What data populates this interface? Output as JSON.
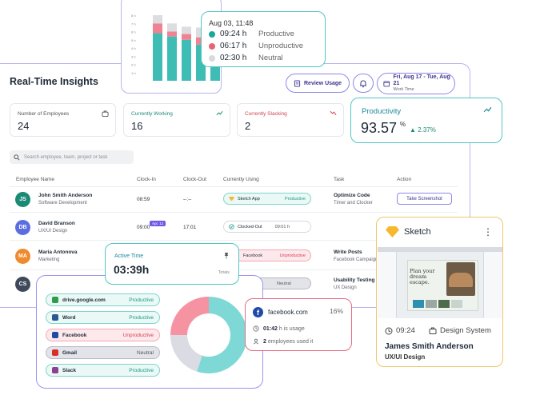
{
  "bar_chart": {
    "tick_labels": [
      "8 h",
      "7 h",
      "6 h",
      "5 h",
      "4 h",
      "3 h",
      "2 h",
      "1 h"
    ],
    "bars": [
      {
        "productive": 5.8,
        "unproductive": 1.2,
        "neutral": 1.0
      },
      {
        "productive": 5.4,
        "unproductive": 0.6,
        "neutral": 1.0
      },
      {
        "productive": 5.0,
        "unproductive": 0.7,
        "neutral": 0.9
      },
      {
        "productive": 4.4,
        "unproductive": 0.9,
        "neutral": 1.2
      },
      {
        "productive": 3.2,
        "unproductive": 0.6,
        "neutral": 1.0
      },
      {
        "productive": 2.0,
        "unproductive": 0.0,
        "neutral": 0.0
      }
    ]
  },
  "tooltip": {
    "when": "Aug 03, 11:48",
    "rows": [
      {
        "hours": "09:24 h",
        "label": "Productive",
        "color": "#1aa897"
      },
      {
        "hours": "06:17 h",
        "label": "Unproductive",
        "color": "#e56476"
      },
      {
        "hours": "02:30 h",
        "label": "Neutral",
        "color": "#d7d9dd"
      }
    ]
  },
  "main": {
    "title": "Real-Time Insights",
    "review_label": "Review Usage",
    "date_range": "Fri, Aug 17 - Tue, Aug 21",
    "date_sub": "Work Time"
  },
  "stats": {
    "employees": {
      "label": "Number of Employees",
      "value": "24"
    },
    "working": {
      "label": "Currently Working",
      "value": "16"
    },
    "slacking": {
      "label": "Currently Slacking",
      "value": "2"
    }
  },
  "productivity": {
    "title": "Productivity",
    "value": "93.57",
    "unit": "%",
    "delta": "2.37%"
  },
  "search": {
    "placeholder": "Search employee, team, project or task"
  },
  "table": {
    "headers": [
      "Employee Name",
      "Clock-In",
      "Clock-Out",
      "Currently Using",
      "Task",
      "Action"
    ],
    "rows": [
      {
        "initials": "JS",
        "avatar_color": "#1b8a75",
        "name": "John Smith Anderson",
        "role": "Software Development",
        "clock_in": "08:59",
        "clock_out": "--:--",
        "app": "Sketch App",
        "app_status": "Productive",
        "task": "Optimize Code",
        "task_sub": "Timer and Clocker",
        "action": "Take Screenshot"
      },
      {
        "initials": "DB",
        "avatar_color": "#5b6ee0",
        "name": "David Branson",
        "role": "UX/UI Design",
        "clock_in": "09:00",
        "clock_out": "17:01",
        "app": "Clocked-Out",
        "app_status": "09:01 h",
        "task": "",
        "task_sub": "",
        "action": ""
      },
      {
        "initials": "MA",
        "avatar_color": "#ef8a2e",
        "name": "Maria Antonova",
        "role": "Marketing",
        "clock_in": "",
        "clock_out": "",
        "app": "Facebook",
        "app_status": "Unproductive",
        "task": "Write Posts",
        "task_sub": "Facebook Campaign",
        "action": ""
      },
      {
        "initials": "CS",
        "avatar_color": "#3e4a5c",
        "name": "",
        "role": "",
        "clock_in": "",
        "clock_out": "",
        "app": "",
        "app_status": "Neutral",
        "task": "Usability Testing",
        "task_sub": "UX Design",
        "action": ""
      }
    ],
    "app_badge": "Apr. 12"
  },
  "active_time": {
    "title": "Active Time",
    "value": "03:39h",
    "sub": "Totals"
  },
  "usage": {
    "items": [
      {
        "name": "drive.google.com",
        "status": "Productive",
        "kind": "prod",
        "icon_color": "#2e9d4b"
      },
      {
        "name": "Word",
        "status": "Productive",
        "kind": "prod",
        "icon_color": "#2b5797"
      },
      {
        "name": "Facebook",
        "status": "Unproductive",
        "kind": "unp",
        "icon_color": "#1f4aa8"
      },
      {
        "name": "Gmail",
        "status": "Neutral",
        "kind": "neu",
        "icon_color": "#d93025"
      },
      {
        "name": "Slack",
        "status": "Productive",
        "kind": "prod",
        "icon_color": "#8e3f8f"
      }
    ],
    "donut": [
      {
        "label": "Productive",
        "value": 55,
        "color": "#7ed9d6"
      },
      {
        "label": "Neutral",
        "value": 20,
        "color": "#dadbe3"
      },
      {
        "label": "Unproductive",
        "value": 25,
        "color": "#f593a3"
      }
    ]
  },
  "facebook_popup": {
    "name": "facebook.com",
    "percent": "16%",
    "usage_hours": "01:42",
    "usage_text": "h is usage",
    "employees_count": "2",
    "employees_text": "employees used it"
  },
  "sketch": {
    "title": "Sketch",
    "time": "09:24",
    "project": "Design System",
    "user": "James Smith Anderson",
    "role": "UX/UI Design",
    "shot_headline": "Plan your dream escape."
  }
}
